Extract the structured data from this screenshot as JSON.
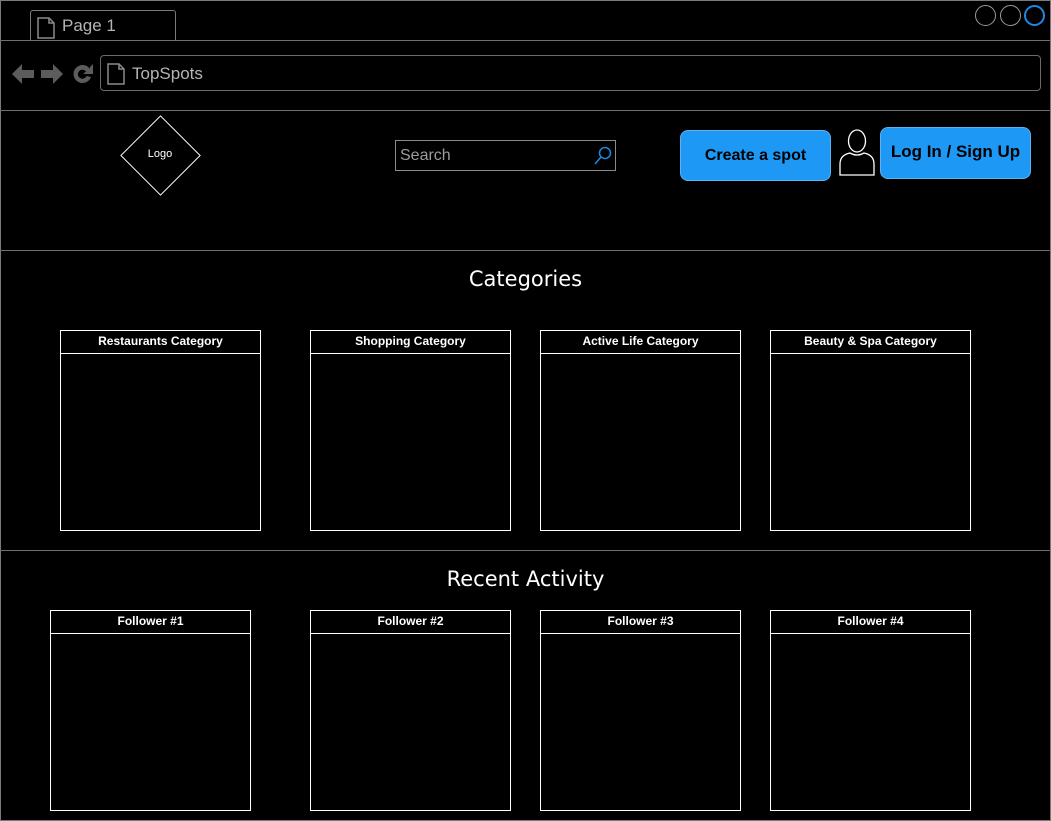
{
  "browser": {
    "tab_label": "Page 1",
    "address": "TopSpots"
  },
  "header": {
    "logo_text": "Logo",
    "search_placeholder": "Search",
    "create_button": "Create a spot",
    "login_button": "Log In / Sign Up"
  },
  "categories": {
    "title": "Categories",
    "items": [
      {
        "label": "Restaurants Category"
      },
      {
        "label": "Shopping Category"
      },
      {
        "label": "Active Life Category"
      },
      {
        "label": "Beauty & Spa Category"
      }
    ]
  },
  "activity": {
    "title": "Recent Activity",
    "items": [
      {
        "label": "Follower #1"
      },
      {
        "label": "Follower #2"
      },
      {
        "label": "Follower #3"
      },
      {
        "label": "Follower #4"
      }
    ]
  },
  "colors": {
    "background": "#000000",
    "accent": "#1e98f5",
    "border": "#ffffff"
  },
  "icons": [
    "document-icon",
    "back-arrow-icon",
    "forward-arrow-icon",
    "reload-icon",
    "search-icon",
    "user-icon",
    "window-button-icon"
  ]
}
